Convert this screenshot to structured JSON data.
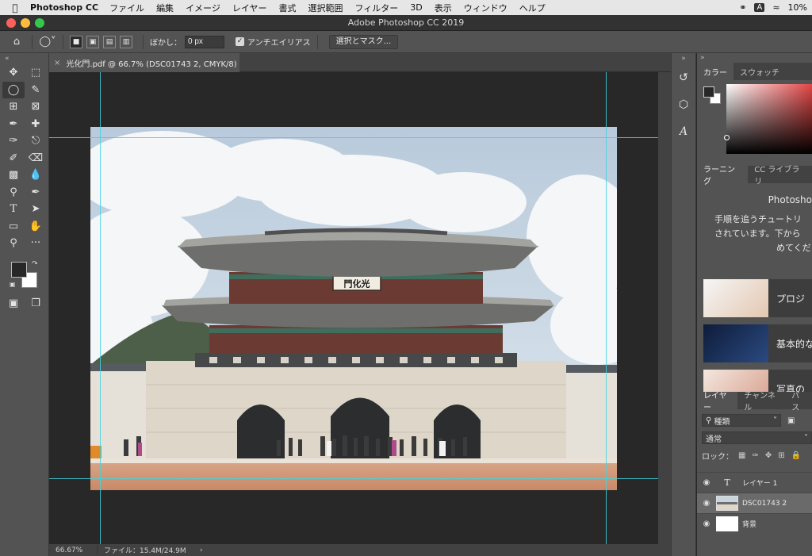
{
  "menubar": {
    "app_name": "Photoshop CC",
    "items": [
      "ファイル",
      "編集",
      "イメージ",
      "レイヤー",
      "書式",
      "選択範囲",
      "フィルター",
      "3D",
      "表示",
      "ウィンドウ",
      "ヘルプ"
    ],
    "battery": "10%"
  },
  "window": {
    "title": "Adobe Photoshop CC 2019"
  },
  "options": {
    "feather_label": "ぼかし：",
    "feather_value": "0 px",
    "antialias_label": "アンチエイリアス",
    "select_mask_label": "選択とマスク..."
  },
  "document": {
    "tab_label": "光化門.pdf @ 66.7% (DSC01743 2, CMYK/8)",
    "sign_text": "門化光"
  },
  "status": {
    "zoom": "66.67%",
    "file_info": "ファイル：15.4M/24.9M"
  },
  "color_panel": {
    "tabs": [
      "カラー",
      "スウォッチ"
    ]
  },
  "learn_panel": {
    "tabs": [
      "ラーニング",
      "CC ライブラリ"
    ],
    "title": "Photosho",
    "desc_lines": [
      "手順を追うチュートリ",
      "されています。下から",
      "めてくだ"
    ],
    "cards": [
      "プロジ",
      "基本的な",
      "写真の"
    ]
  },
  "layers_panel": {
    "tabs": [
      "レイヤー",
      "チャンネル",
      "パス"
    ],
    "filter_label": "種類",
    "blend_mode": "通常",
    "lock_label": "ロック：",
    "layers": [
      {
        "name": "レイヤー 1",
        "type": "text"
      },
      {
        "name": "DSC01743 2",
        "type": "image"
      },
      {
        "name": "背景",
        "type": "fill"
      }
    ]
  },
  "colors": {
    "accent_guide": "#3fd4e0",
    "panel_bg": "#535353",
    "canvas_bg": "#282828"
  }
}
